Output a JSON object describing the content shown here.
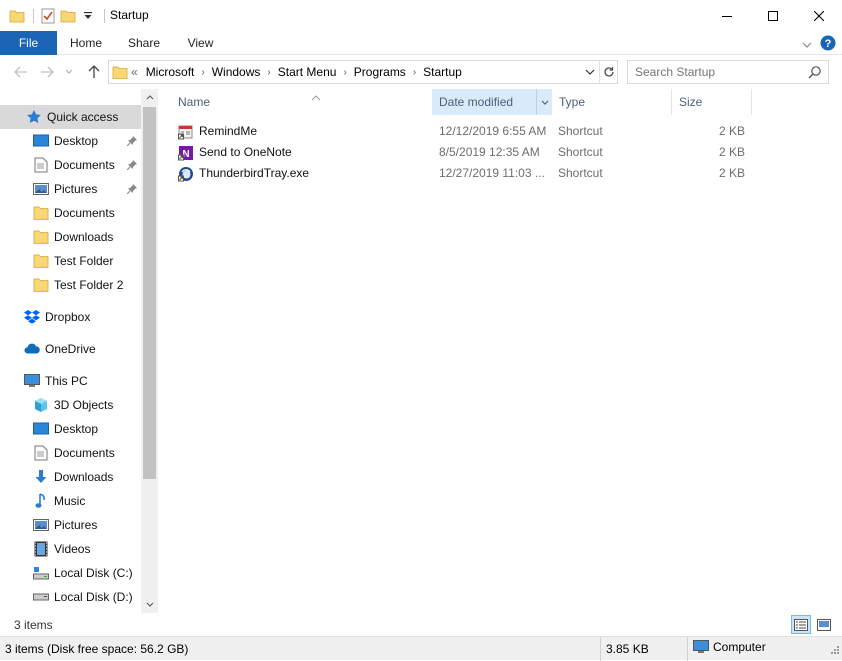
{
  "window": {
    "title": "Startup"
  },
  "ribbon": {
    "tabs": [
      "File",
      "Home",
      "Share",
      "View"
    ]
  },
  "address": {
    "overflow": "«",
    "crumbs": [
      "Microsoft",
      "Windows",
      "Start Menu",
      "Programs",
      "Startup"
    ]
  },
  "search": {
    "placeholder": "Search Startup"
  },
  "nav": {
    "items": [
      {
        "label": "Quick access"
      },
      {
        "label": "Desktop"
      },
      {
        "label": "Documents"
      },
      {
        "label": "Pictures"
      },
      {
        "label": "Documents"
      },
      {
        "label": "Downloads"
      },
      {
        "label": "Test Folder"
      },
      {
        "label": "Test Folder 2"
      },
      {
        "label": "Dropbox"
      },
      {
        "label": "OneDrive"
      },
      {
        "label": "This PC"
      },
      {
        "label": "3D Objects"
      },
      {
        "label": "Desktop"
      },
      {
        "label": "Documents"
      },
      {
        "label": "Downloads"
      },
      {
        "label": "Music"
      },
      {
        "label": "Pictures"
      },
      {
        "label": "Videos"
      },
      {
        "label": "Local Disk (C:)"
      },
      {
        "label": "Local Disk (D:)"
      }
    ]
  },
  "columns": {
    "name": "Name",
    "date": "Date modified",
    "type": "Type",
    "size": "Size"
  },
  "files": [
    {
      "name": "RemindMe",
      "date": "12/12/2019 6:55 AM",
      "type": "Shortcut",
      "size": "2 KB",
      "icon": "remindme-icon"
    },
    {
      "name": "Send to OneNote",
      "date": "8/5/2019 12:35 AM",
      "type": "Shortcut",
      "size": "2 KB",
      "icon": "onenote-icon"
    },
    {
      "name": "ThunderbirdTray.exe",
      "date": "12/27/2019 11:03 ...",
      "type": "Shortcut",
      "size": "2 KB",
      "icon": "thunderbird-icon"
    }
  ],
  "footer": {
    "item_count": "3 items"
  },
  "status": {
    "summary": "3 items (Disk free space: 56.2 GB)",
    "size": "3.85 KB",
    "location": "Computer"
  },
  "colors": {
    "accent": "#1a65b5",
    "selected_nav": "#d9d9d9",
    "sorted_header": "#d9ebf9",
    "folder": "#f8d775"
  }
}
